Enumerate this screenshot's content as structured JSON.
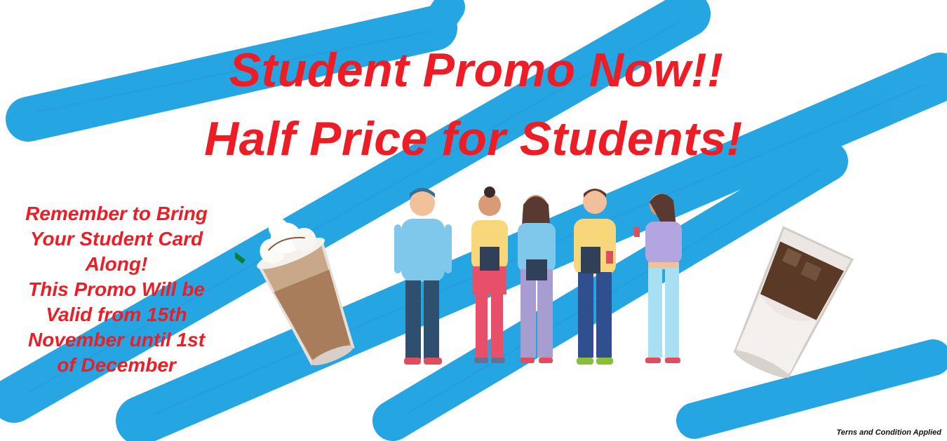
{
  "banner": {
    "headline_line1": "Student Promo Now!!",
    "headline_line2": "Half Price for Students!",
    "reminder_lines": [
      "Remember to Bring",
      "Your Student Card",
      "Along!",
      "This Promo Will be",
      "Valid from 15th",
      "November until 1st",
      "of December"
    ],
    "fine_print": "Terns and Condition Applied"
  },
  "colors": {
    "headline": "#ee1c25",
    "brush_stroke": "#1ba1e2",
    "background": "#ffffff"
  },
  "images": {
    "left_drink": "frappe-drink-icon",
    "right_drink": "iced-latte-icon",
    "group": "students-group-illustration"
  }
}
